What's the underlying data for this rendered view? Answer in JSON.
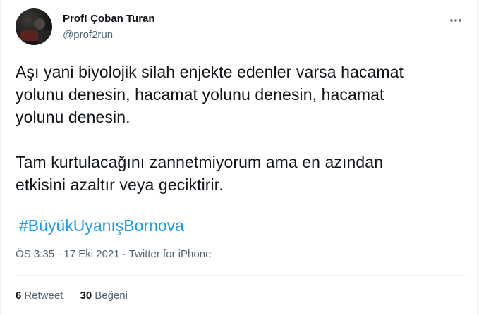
{
  "author": {
    "display_name": "Prof! Çoban Turan",
    "handle": "@prof2run"
  },
  "tweet": {
    "lines": [
      "Aşı yani biyolojik silah enjekte edenler varsa hacamat",
      "yolunu denesin, hacamat yolunu denesin, hacamat",
      "yolunu denesin.",
      "",
      "Tam kurtulacağını zannetmiyorum ama en azından",
      "etkisini azaltır veya geciktirir."
    ],
    "hashtag": "#BüyükUyanışBornova"
  },
  "meta": {
    "time": "ÖS 3:35",
    "separator": "·",
    "date": "17 Eki 2021",
    "source": "Twitter for iPhone"
  },
  "stats": {
    "retweets_count": "6",
    "retweets_label": "Retweet",
    "likes_count": "30",
    "likes_label": "Beğeni"
  },
  "icons": {
    "more": "more-horizontal-icon"
  },
  "colors": {
    "link": "#1d9bf0",
    "secondary_text": "#536471",
    "primary_text": "#0f1419",
    "border": "#eff3f4"
  }
}
